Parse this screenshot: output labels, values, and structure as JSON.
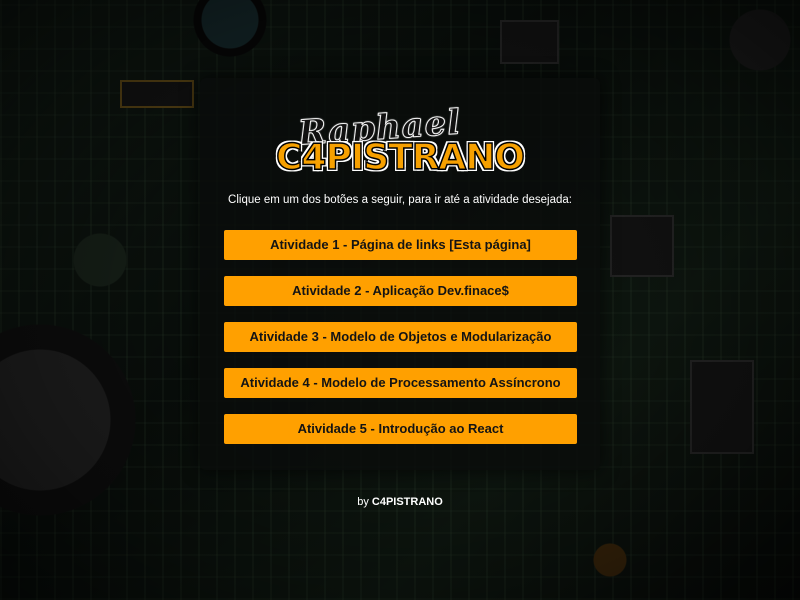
{
  "logo": {
    "script_text": "Raphael",
    "main_text": "C4PISTRANO"
  },
  "instruction": "Clique em um dos botões a seguir, para ir até a atividade desejada:",
  "activities": [
    {
      "label": "Atividade 1 - Página de links [Esta página]"
    },
    {
      "label": "Atividade 2 - Aplicação Dev.finace$"
    },
    {
      "label": "Atividade 3 - Modelo de Objetos e Modularização"
    },
    {
      "label": "Atividade 4 - Modelo de Processamento Assíncrono"
    },
    {
      "label": "Atividade 5 - Introdução ao React"
    }
  ],
  "footer": {
    "prefix": "by",
    "author": "C4PISTRANO"
  },
  "colors": {
    "accent": "#ffa000",
    "text": "#ffffff",
    "panel": "#0a0c0b"
  }
}
